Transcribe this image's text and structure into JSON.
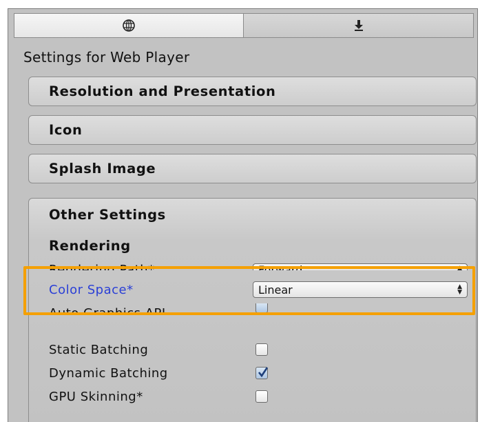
{
  "tabs": [
    {
      "icon": "globe-icon",
      "glyph": "◎"
    },
    {
      "icon": "download-icon",
      "glyph": "⬇"
    }
  ],
  "header": {
    "settings_for": "Settings for Web Player"
  },
  "sections": {
    "resolution": "Resolution and Presentation",
    "icon": "Icon",
    "splash": "Splash Image",
    "other": "Other Settings"
  },
  "rendering": {
    "title": "Rendering",
    "rendering_path_label": "Rendering Path*",
    "rendering_path_value": "Forward",
    "color_space_label": "Color Space*",
    "color_space_value": "Linear",
    "auto_graphics_label": "Auto Graphics API",
    "auto_graphics_checked": true,
    "static_batching_label": "Static Batching",
    "static_batching_checked": false,
    "dynamic_batching_label": "Dynamic Batching",
    "dynamic_batching_checked": true,
    "gpu_skinning_label": "GPU Skinning*",
    "gpu_skinning_checked": false
  },
  "colors": {
    "highlight": "#f5a000",
    "modified_label": "#2a3fd6",
    "panel_bg": "#c2c2c2"
  }
}
